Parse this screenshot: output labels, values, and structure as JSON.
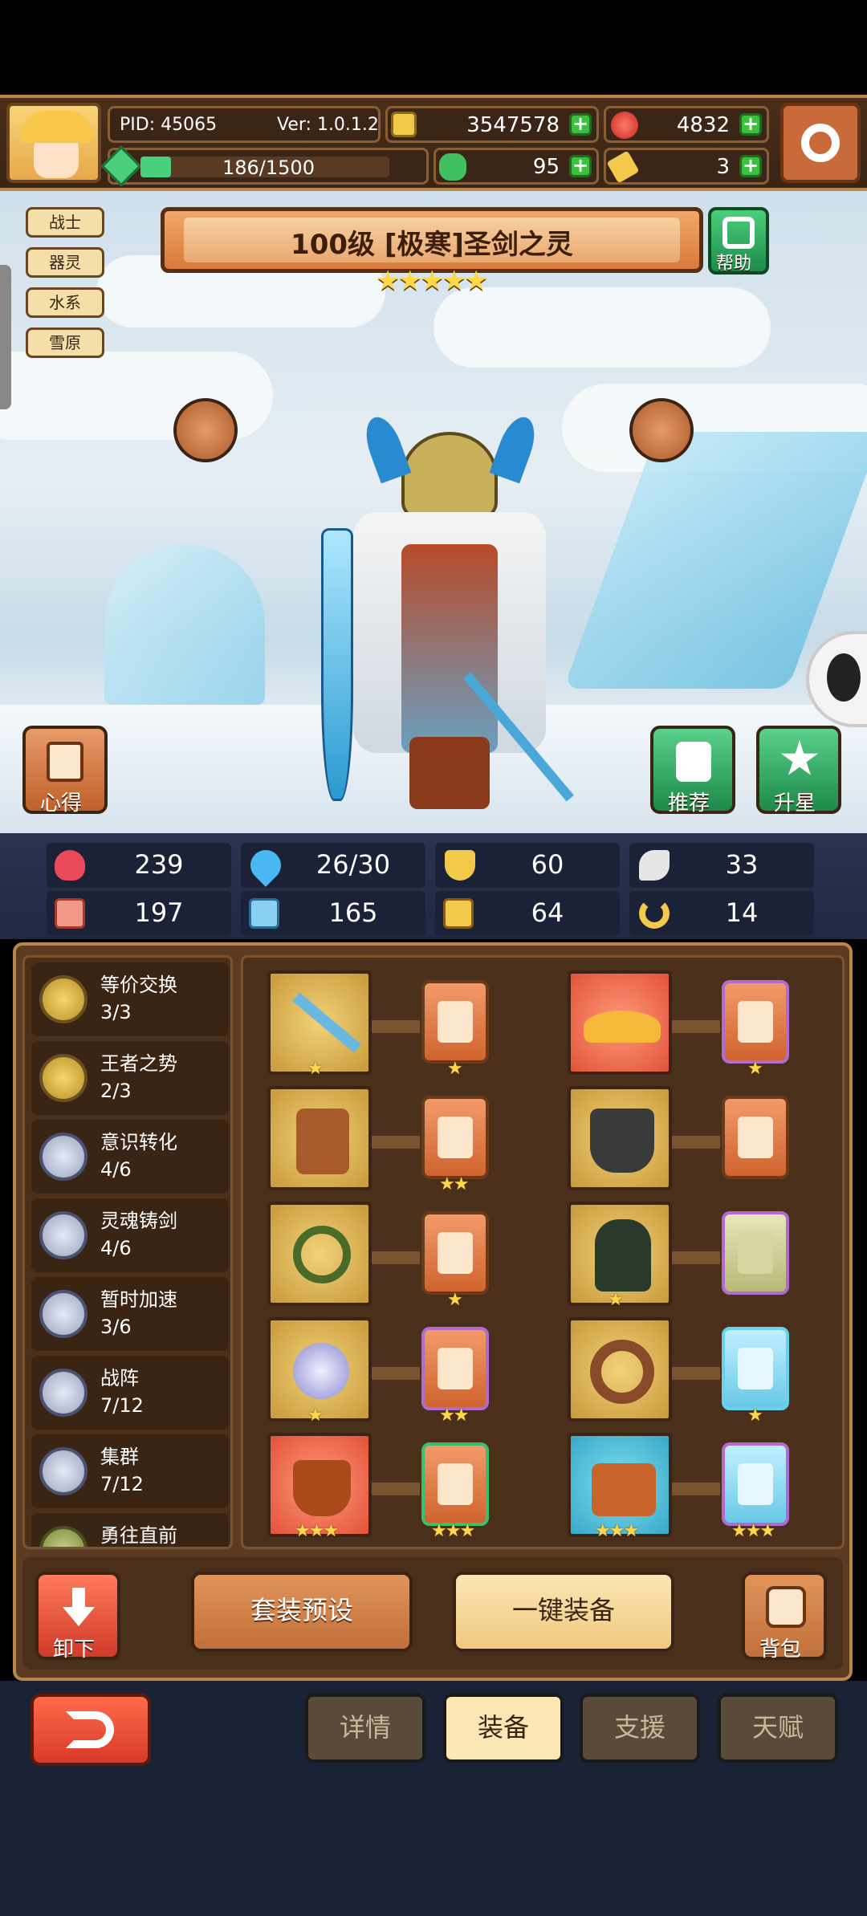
{
  "header": {
    "pid": "PID: 45065",
    "version": "Ver: 1.0.1.2",
    "gold": "3547578",
    "rubies": "4832",
    "energy": "186/1500",
    "clover": "95",
    "keys": "3",
    "energy_fraction": 0.124
  },
  "hero": {
    "title": "100级 [极寒]圣剑之灵",
    "stars": "★★★★★",
    "help_label": "帮助",
    "tags": [
      "战士",
      "器灵",
      "水系",
      "雪原"
    ]
  },
  "side_buttons": {
    "insight": "心得",
    "recommend": "推荐",
    "star_up": "升星"
  },
  "stats": [
    {
      "icon": "heart-icon",
      "value": "239"
    },
    {
      "icon": "water-drop-icon",
      "value": "26/30"
    },
    {
      "icon": "shield-icon",
      "value": "60"
    },
    {
      "icon": "wing-icon",
      "value": "33"
    },
    {
      "icon": "fist-icon",
      "value": "197"
    },
    {
      "icon": "book-icon",
      "value": "165"
    },
    {
      "icon": "boot-icon",
      "value": "64"
    },
    {
      "icon": "horseshoe-icon",
      "value": "14"
    }
  ],
  "skills": [
    {
      "name": "等价交换",
      "progress": "3/3"
    },
    {
      "name": "王者之势",
      "progress": "2/3"
    },
    {
      "name": "意识转化",
      "progress": "4/6"
    },
    {
      "name": "灵魂铸剑",
      "progress": "4/6"
    },
    {
      "name": "暂时加速",
      "progress": "3/6"
    },
    {
      "name": "战阵",
      "progress": "7/12"
    },
    {
      "name": "集群",
      "progress": "7/12"
    },
    {
      "name": "勇往直前",
      "progress": ""
    }
  ],
  "equipment": [
    {
      "slot_stars": "★",
      "card_stars": "★"
    },
    {
      "slot_stars": "",
      "card_stars": "★"
    },
    {
      "slot_stars": "",
      "card_stars": "★★"
    },
    {
      "slot_stars": "",
      "card_stars": "★"
    },
    {
      "slot_stars": "",
      "card_stars": "★"
    },
    {
      "slot_stars": "★",
      "card_stars": ""
    },
    {
      "slot_stars": "★",
      "card_stars": "★★"
    },
    {
      "slot_stars": "",
      "card_stars": "★"
    },
    {
      "slot_stars": "★★★",
      "card_stars": "★★★"
    },
    {
      "slot_stars": "★★★",
      "card_stars": "★★★"
    }
  ],
  "actions": {
    "unequip": "卸下",
    "preset": "套装预设",
    "auto_equip": "一键装备",
    "backpack": "背包"
  },
  "tabs": [
    "详情",
    "装备",
    "支援",
    "天赋"
  ]
}
